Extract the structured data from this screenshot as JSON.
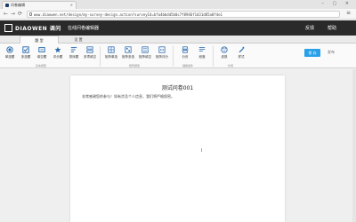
{
  "browser": {
    "tab_title": "问卷编辑",
    "tab_close": "×",
    "window_controls": "– ▢ ×",
    "url": "www.diaowen.net/design/my-survey-design.action?surveyId=bfa4bbdd5b0c7f8946f1d31d85a8f4e1",
    "back": "←",
    "forward": "→",
    "reload": "⟳",
    "menu": "≡"
  },
  "header": {
    "logo_text": "DIAOWEN 调问",
    "title": "在线问卷编辑器",
    "links": [
      "反馈",
      "帮助"
    ]
  },
  "ribbon": {
    "tabs": [
      "题 型",
      "设 置"
    ],
    "active_tab": 0,
    "group1_tools": [
      "单选题",
      "多选题",
      "填空题",
      "评分题",
      "排序题",
      "多项填空"
    ],
    "group1_label": "基本题型",
    "group2_tools": [
      "矩阵单选",
      "矩阵多选",
      "矩阵填空",
      "矩阵评分"
    ],
    "group2_label": "矩阵题型",
    "group3_tools": [
      "分页",
      "段落"
    ],
    "group3_label": "辅助组件",
    "group4_tools": [
      "皮肤",
      "样式"
    ],
    "group4_label": "外观",
    "save_label": "保 存",
    "more_label": "发布"
  },
  "document": {
    "title": "测试问卷001",
    "intro": "非常感谢您的参与！如有涉及个人信息，我们将严格保密。",
    "cursor": "I"
  },
  "colors": {
    "header_bg": "#2a2a2a",
    "accent": "#29a0e8",
    "icon_blue": "#2c6db0",
    "page_bg": "#ffffff"
  }
}
